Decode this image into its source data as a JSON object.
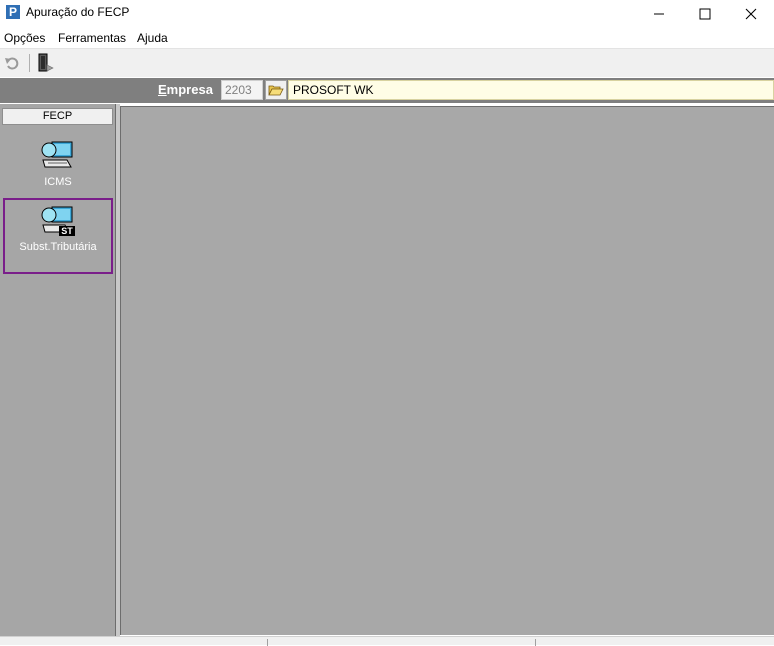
{
  "window": {
    "app_icon_letter": "P",
    "title": "Apuração do FECP",
    "icons": [
      "minimize-icon",
      "maximize-icon",
      "close-icon"
    ]
  },
  "menu": {
    "items": [
      "Opções",
      "Ferramentas",
      "Ajuda"
    ]
  },
  "toolbar": {
    "icons": [
      "undo-icon",
      "exit-door-icon"
    ]
  },
  "company": {
    "label_first": "E",
    "label_rest": "mpresa",
    "code": "2203",
    "name": "PROSOFT WK",
    "browse_icon": "folder-open-icon"
  },
  "sidebar": {
    "header": "FECP",
    "modules": [
      {
        "label": "ICMS",
        "icon": "icms-computer-icon"
      },
      {
        "label": "Subst.Tributária",
        "icon": "st-computer-icon",
        "badge": "ST",
        "selected": true
      }
    ]
  },
  "colors": {
    "selection_border": "#7a1e8a",
    "company_bar": "#7f7f7f",
    "name_field_bg": "#fffde6",
    "workspace": "#a8a8a8"
  }
}
